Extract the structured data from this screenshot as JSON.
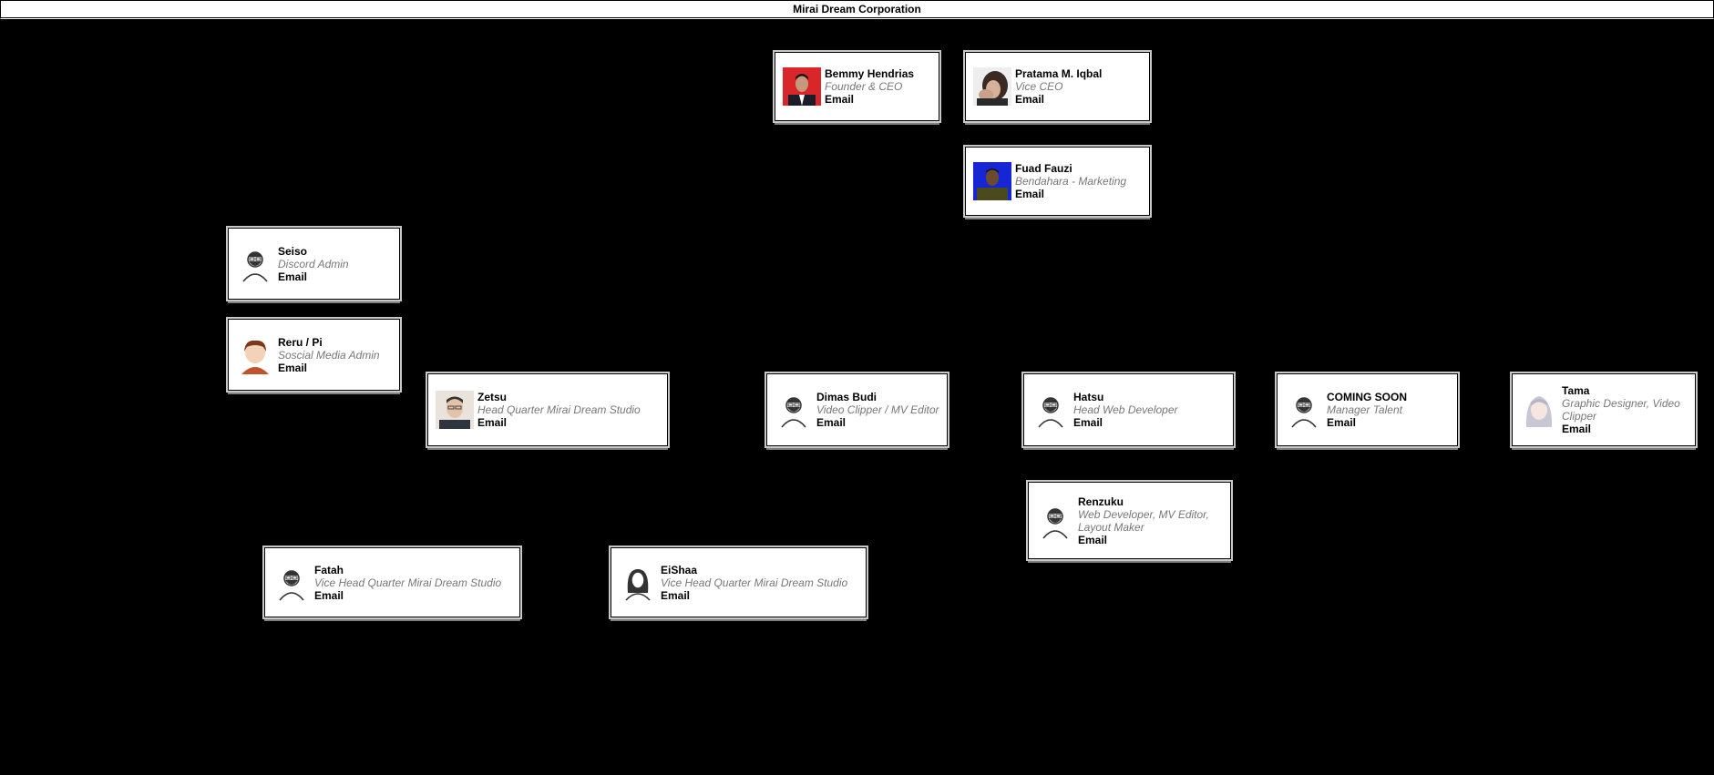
{
  "title": "Mirai Dream Corporation",
  "nodes": {
    "bemmy": {
      "name": "Bemmy Hendrias",
      "role": "Founder & CEO",
      "email": "Email",
      "avatar": "photo-red-bg-icon"
    },
    "pratama": {
      "name": "Pratama M. Iqbal",
      "role": "Vice CEO",
      "email": "Email",
      "avatar": "photo-hand-face-icon"
    },
    "fuad": {
      "name": "Fuad Fauzi",
      "role": "Bendahara - Marketing",
      "email": "Email",
      "avatar": "photo-blue-bg-icon"
    },
    "seiso": {
      "name": "Seiso",
      "role": "Discord Admin",
      "email": "Email",
      "avatar": "bearded-man-icon"
    },
    "reru": {
      "name": "Reru / Pi",
      "role": "Soscial Media Admin",
      "email": "Email",
      "avatar": "anime-character-icon"
    },
    "zetsu": {
      "name": "Zetsu",
      "role": "Head Quarter Mirai Dream Studio",
      "email": "Email",
      "avatar": "photo-man-glasses-icon"
    },
    "dimas": {
      "name": "Dimas Budi",
      "role": "Video Clipper / MV Editor",
      "email": "Email",
      "avatar": "bearded-man-icon"
    },
    "hatsu": {
      "name": "Hatsu",
      "role": "Head Web Developer",
      "email": "Email",
      "avatar": "bearded-man-icon"
    },
    "coming": {
      "name": "COMING SOON",
      "role": "Manager Talent",
      "email": "Email",
      "avatar": "bearded-man-icon"
    },
    "tama": {
      "name": "Tama",
      "role": "Graphic Designer, Video Clipper",
      "email": "Email",
      "avatar": "anime-girl-icon"
    },
    "renzuku": {
      "name": "Renzuku",
      "role": "Web Developer, MV Editor, Layout Maker",
      "email": "Email",
      "avatar": "bearded-man-icon"
    },
    "fatah": {
      "name": "Fatah",
      "role": "Vice Head Quarter Mirai Dream Studio",
      "email": "Email",
      "avatar": "bearded-man-icon"
    },
    "eishaa": {
      "name": "EiShaa",
      "role": "Vice Head Quarter Mirai Dream Studio",
      "email": "Email",
      "avatar": "woman-icon"
    }
  },
  "colors": {
    "background": "#000000",
    "card": "#ffffff",
    "role_text": "#777777",
    "connector": "#000000"
  }
}
